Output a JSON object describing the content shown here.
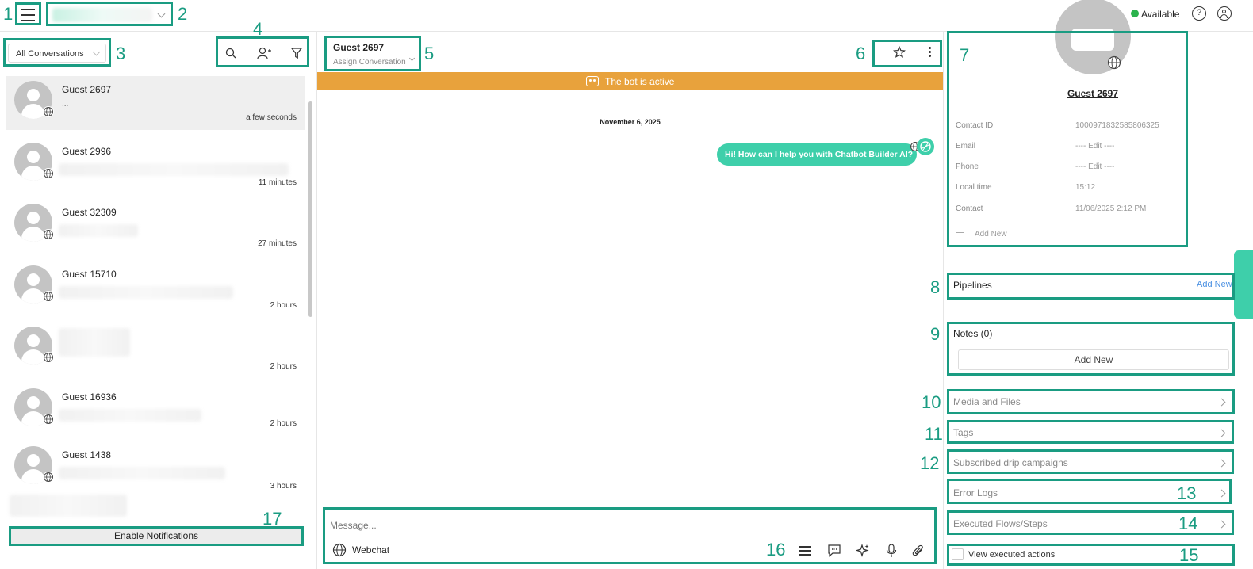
{
  "annotations": [
    "1",
    "2",
    "3",
    "4",
    "5",
    "6",
    "7",
    "8",
    "9",
    "10",
    "11",
    "12",
    "13",
    "14",
    "15",
    "16",
    "17"
  ],
  "topbar": {
    "status_label": "Available",
    "status_color": "#2bb24c"
  },
  "left": {
    "filter_label": "All Conversations",
    "conversations": [
      {
        "name": "Guest 2697",
        "preview": "...",
        "time": "a few seconds",
        "active": true
      },
      {
        "name": "Guest 2996",
        "preview": "",
        "time": "11 minutes"
      },
      {
        "name": "Guest 32309",
        "preview": "",
        "time": "27 minutes"
      },
      {
        "name": "Guest 15710",
        "preview": "",
        "time": "2 hours"
      },
      {
        "name": "",
        "preview": "",
        "time": "2 hours"
      },
      {
        "name": "Guest 16936",
        "preview": "",
        "time": "2 hours"
      },
      {
        "name": "Guest 1438",
        "preview": "",
        "time": "3 hours"
      }
    ],
    "notifications_button": "Enable Notifications"
  },
  "chat": {
    "contact_name": "Guest 2697",
    "assign_label": "Assign Conversation",
    "bot_banner": "The bot is active",
    "banner_color": "#e8a23c",
    "date_label": "November 6, 2025",
    "messages": [
      {
        "text": "Hi! How can I help you with Chatbot Builder AI?",
        "from": "bot"
      }
    ],
    "composer_placeholder": "Message...",
    "channel_label": "Webchat",
    "accent": "#3ecfaa"
  },
  "contact": {
    "name": "Guest 2697",
    "fields": [
      {
        "label": "Contact ID",
        "value": "1000971832585806325"
      },
      {
        "label": "Email",
        "value": "---- Edit ----"
      },
      {
        "label": "Phone",
        "value": "---- Edit ----"
      },
      {
        "label": "Local time",
        "value": "15:12"
      },
      {
        "label": "Contact",
        "value": "11/06/2025 2:12 PM"
      }
    ],
    "add_new_field": "Add New",
    "pipelines_label": "Pipelines",
    "pipelines_add": "Add New",
    "notes_label": "Notes (0)",
    "notes_add": "Add New",
    "sections": [
      "Media and Files",
      "Tags",
      "Subscribed drip campaigns",
      "Error Logs",
      "Executed Flows/Steps"
    ],
    "view_executed": "View executed actions"
  }
}
